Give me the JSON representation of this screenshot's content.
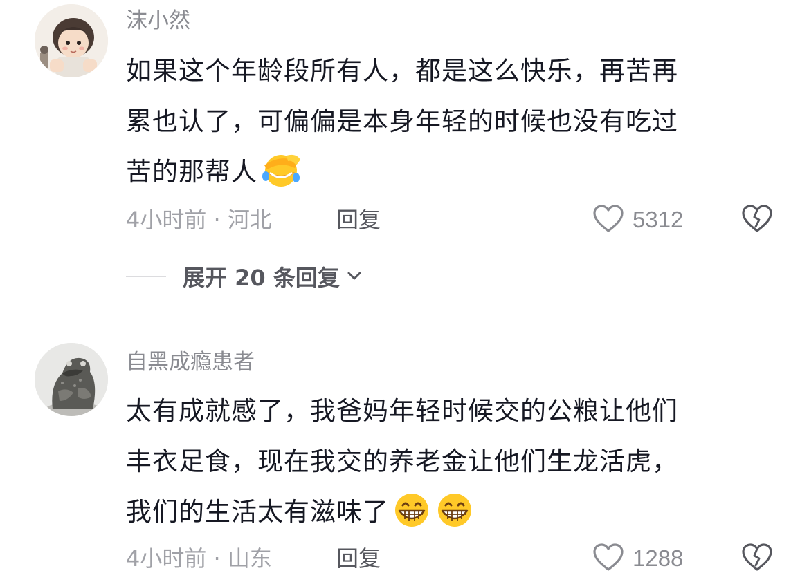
{
  "comments": [
    {
      "username": "沫小然",
      "lines": [
        "如果这个年龄段所有人，都是这么快乐，再苦再",
        "累也认了，可偏偏是本身年轻的时候也没有吃过",
        "苦的那帮人"
      ],
      "emoji": [
        "facepalm-laughing-emoji"
      ],
      "time_location": "4小时前 · 河北",
      "reply_label": "回复",
      "likes": "5312",
      "expand_label": "展开 20 条回复"
    },
    {
      "username": "自黑成瘾患者",
      "lines": [
        "太有成就感了，我爸妈年轻时候交的公粮让他们",
        "丰衣足食，现在我交的养老金让他们生龙活虎，",
        "我们的生活太有滋味了"
      ],
      "emoji": [
        "grinning-emoji",
        "grinning-emoji"
      ],
      "time_location": "4小时前 · 山东",
      "reply_label": "回复",
      "likes": "1288"
    }
  ],
  "icons": {
    "like": "heart-outline-icon",
    "dislike": "broken-heart-icon",
    "expand": "chevron-down-icon"
  },
  "colors": {
    "primary_text": "#161823",
    "secondary_text": "#8a8b91",
    "action_text": "#56575e"
  }
}
